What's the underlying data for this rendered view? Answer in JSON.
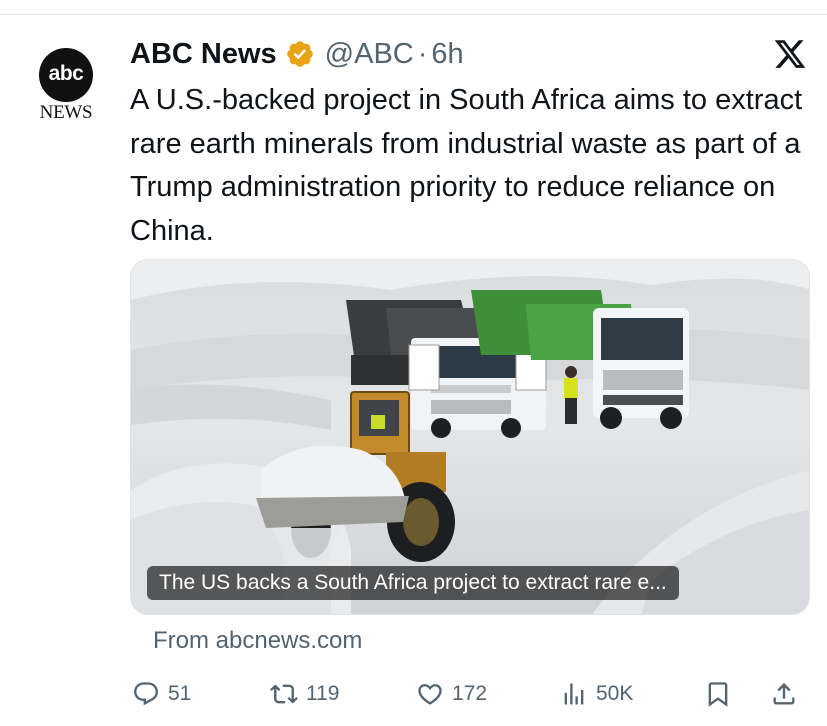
{
  "account": {
    "display_name": "ABC News",
    "handle": "@ABC",
    "separator": "·",
    "time": "6h",
    "avatar_top": "abc",
    "avatar_bottom": "NEWS",
    "verified_color": "#E8A415"
  },
  "tweet": {
    "text": "A U.S.-backed project in South Africa aims to extract rare earth minerals from industrial waste as part of a Trump administration priority to reduce reliance on China."
  },
  "card": {
    "caption": "The US backs a South Africa project to extract rare e...",
    "source": "From abcnews.com"
  },
  "actions": {
    "replies": "51",
    "reposts": "119",
    "likes": "172",
    "views": "50K"
  },
  "icons": {
    "close": "x-logo-icon",
    "reply": "reply-icon",
    "repost": "repost-icon",
    "like": "heart-icon",
    "views": "views-icon",
    "bookmark": "bookmark-icon",
    "share": "share-icon"
  }
}
